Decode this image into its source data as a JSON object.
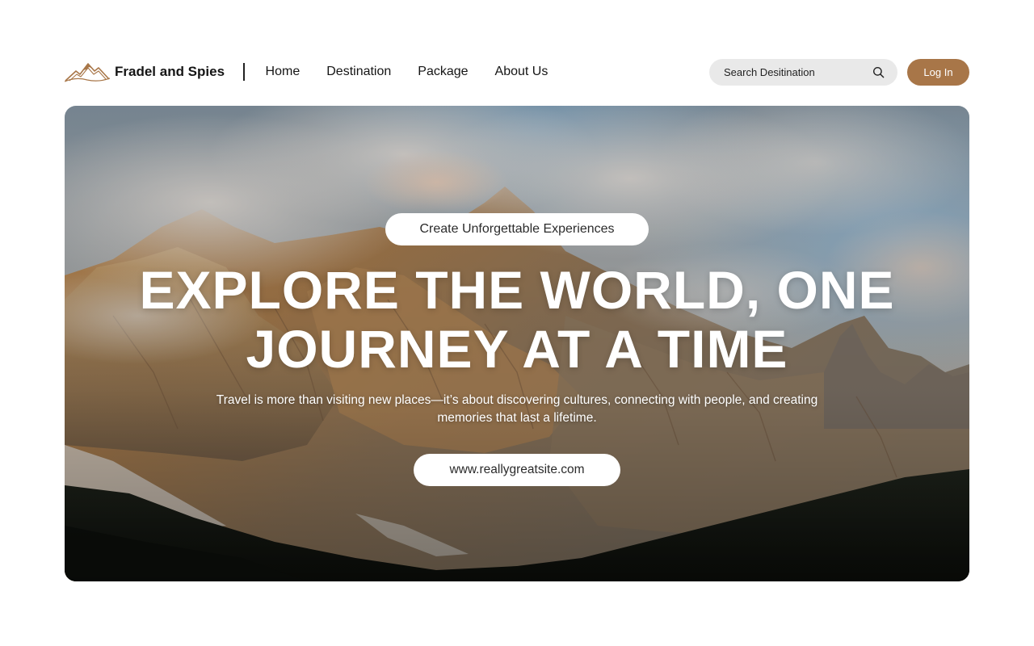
{
  "brand": {
    "name": "Fradel and Spies",
    "logo_icon": "mountain-logo-icon",
    "logo_color": "#a87648"
  },
  "nav": {
    "items": [
      {
        "label": "Home"
      },
      {
        "label": "Destination"
      },
      {
        "label": "Package"
      },
      {
        "label": "About Us"
      }
    ]
  },
  "search": {
    "placeholder": "Search Desitination",
    "value": "",
    "icon": "search-icon"
  },
  "login": {
    "label": "Log In",
    "color": "#a87648"
  },
  "hero": {
    "tagline": "Create Unforgettable Experiences",
    "headline_line1": "EXPLORE THE WORLD, ONE",
    "headline_line2": "JOURNEY AT A TIME",
    "subtext": "Travel is more than visiting new places—it’s about discovering cultures, connecting with people, and creating memories that last a lifetime.",
    "link": "www.reallygreatsite.com",
    "background": "mountain-landscape-photo"
  }
}
